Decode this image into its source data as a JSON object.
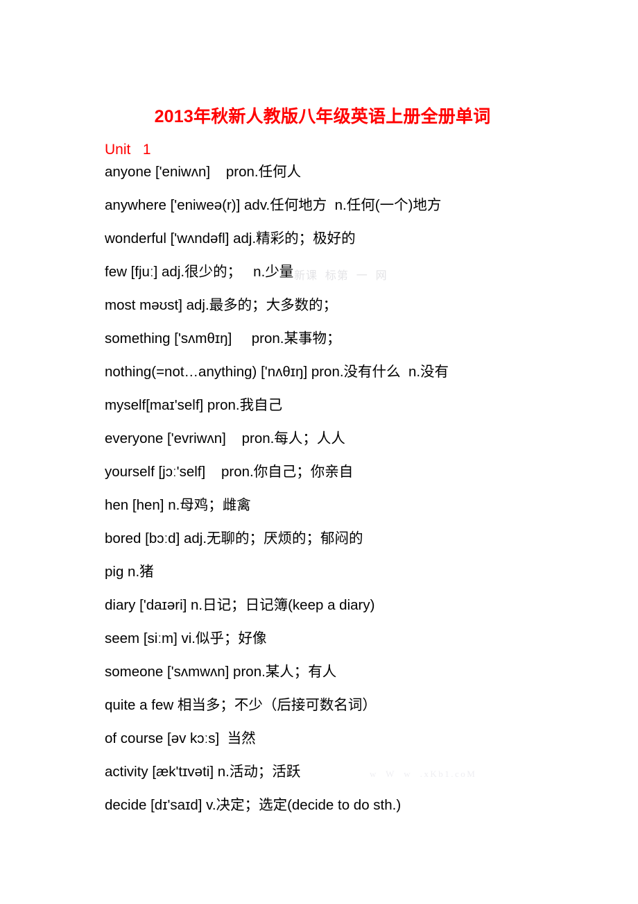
{
  "document": {
    "title": "2013年秋新人教版八年级英语上册全册单词",
    "title_color": "#ff0000",
    "unit_heading": "Unit   1",
    "unit_heading_color": "#ff0000",
    "background_color": "#ffffff",
    "body_text_color": "#000000"
  },
  "watermarks": {
    "middle_cn": "新课  标第  一  网",
    "bottom_url": "w  W  w  .xKb1.coM",
    "color": "#e3e3e6"
  },
  "word_list": [
    {
      "word": "anyone",
      "phonetic": "['eniwʌn]",
      "pos_definition": "pron.任何人",
      "line": "anyone ['eniwʌn]    pron.任何人"
    },
    {
      "word": "anywhere",
      "phonetic": "['eniweə(r)]",
      "pos_definition": "adv.任何地方  n.任何(一个)地方",
      "line": "anywhere ['eniweə(r)] adv.任何地方  n.任何(一个)地方"
    },
    {
      "word": "wonderful",
      "phonetic": "['wʌndəfl]",
      "pos_definition": "adj.精彩的；极好的",
      "line": "wonderful ['wʌndəfl] adj.精彩的；极好的"
    },
    {
      "word": "few",
      "phonetic": "[fjuː]",
      "pos_definition": "adj.很少的；  n.少量",
      "line": "few [fjuː] adj.很少的；   n.少量"
    },
    {
      "word": "most",
      "phonetic": "məʊst]",
      "pos_definition": "adj.最多的；大多数的；",
      "line": "most məʊst] adj.最多的；大多数的；"
    },
    {
      "word": "something",
      "phonetic": "['sʌmθɪŋ]",
      "pos_definition": "pron.某事物；",
      "line": "something ['sʌmθɪŋ]     pron.某事物；"
    },
    {
      "word": "nothing(=not…anything)",
      "phonetic": "['nʌθɪŋ]",
      "pos_definition": "pron.没有什么  n.没有",
      "line": "nothing(=not…anything) ['nʌθɪŋ] pron.没有什么  n.没有"
    },
    {
      "word": "myself",
      "phonetic": "[maɪ'self]",
      "pos_definition": "pron.我自己",
      "line": "myself[maɪ'self] pron.我自己"
    },
    {
      "word": "everyone",
      "phonetic": "['evriwʌn]",
      "pos_definition": "pron.每人；人人",
      "line": "everyone ['evriwʌn]    pron.每人；人人"
    },
    {
      "word": "yourself",
      "phonetic": "[jɔː'self]",
      "pos_definition": "pron.你自己；你亲自",
      "line": "yourself [jɔː'self]    pron.你自己；你亲自"
    },
    {
      "word": "hen",
      "phonetic": "[hen]",
      "pos_definition": "n.母鸡；雌禽",
      "line": "hen [hen] n.母鸡；雌禽"
    },
    {
      "word": "bored",
      "phonetic": "[bɔːd]",
      "pos_definition": "adj.无聊的；厌烦的；郁闷的",
      "line": "bored [bɔːd] adj.无聊的；厌烦的；郁闷的"
    },
    {
      "word": "pig",
      "phonetic": "",
      "pos_definition": "n.猪",
      "line": "pig n.猪"
    },
    {
      "word": "diary",
      "phonetic": "['daɪəri]",
      "pos_definition": "n.日记；日记簿(keep a diary)",
      "line": "diary ['daɪəri] n.日记；日记簿(keep a diary)"
    },
    {
      "word": "seem",
      "phonetic": "[siːm]",
      "pos_definition": "vi.似乎；好像",
      "line": "seem [siːm] vi.似乎；好像"
    },
    {
      "word": "someone",
      "phonetic": "['sʌmwʌn]",
      "pos_definition": "pron.某人；有人",
      "line": "someone ['sʌmwʌn] pron.某人；有人"
    },
    {
      "word": "quite a few",
      "phonetic": "",
      "pos_definition": "相当多；不少（后接可数名词）",
      "line": "quite a few 相当多；不少（后接可数名词）"
    },
    {
      "word": "of course",
      "phonetic": "[əv kɔːs]",
      "pos_definition": "当然",
      "line": "of course [əv kɔːs]  当然"
    },
    {
      "word": "activity",
      "phonetic": "[æk'tɪvəti]",
      "pos_definition": "n.活动；活跃",
      "line": "activity [æk'tɪvəti] n.活动；活跃"
    },
    {
      "word": "decide",
      "phonetic": "[dɪ'saɪd]",
      "pos_definition": "v.决定；选定(decide to do sth.)",
      "line": "decide [dɪ'saɪd] v.决定；选定(decide to do sth.)"
    }
  ]
}
